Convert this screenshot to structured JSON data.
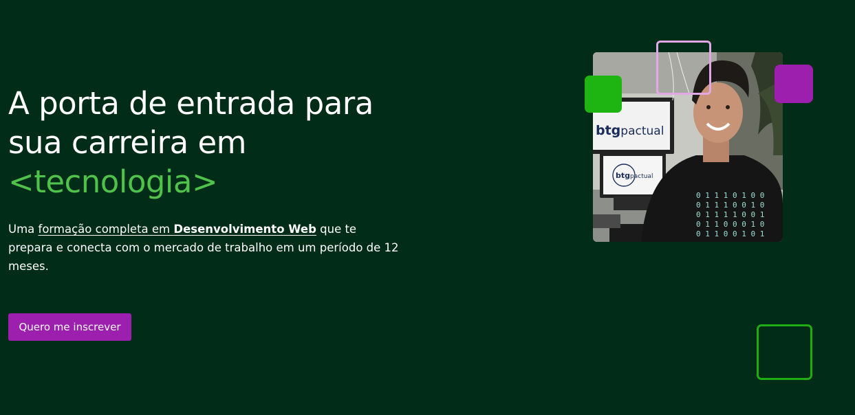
{
  "hero": {
    "headline_line1": "A porta de entrada para",
    "headline_line2": "sua carreira em",
    "headline_accent": "<tecnologia>",
    "lead_part1": "Uma ",
    "lead_link": "formação completa em ",
    "lead_strong": "Desenvolvimento Web",
    "lead_part2": " que te prepara e conecta com o mercado de trabalho em um período de 12 meses.",
    "cta_label": "Quero me inscrever"
  },
  "photo": {
    "monitor_brand": "btg pactual",
    "shirt_rows": [
      "0 1 1 1 0 1 0 0",
      "0 1 1 1 0 0 1 0",
      "0 1 1 1 1 0 0 1",
      "0 1 1 0 0 0 1 0",
      "0 1 1 0 0 1 0 1"
    ]
  },
  "colors": {
    "background": "#012c18",
    "accent_green": "#4fc24c",
    "button_purple": "#9c1fad",
    "deco_green": "#1eb512",
    "deco_pink": "#e2a8e6"
  }
}
